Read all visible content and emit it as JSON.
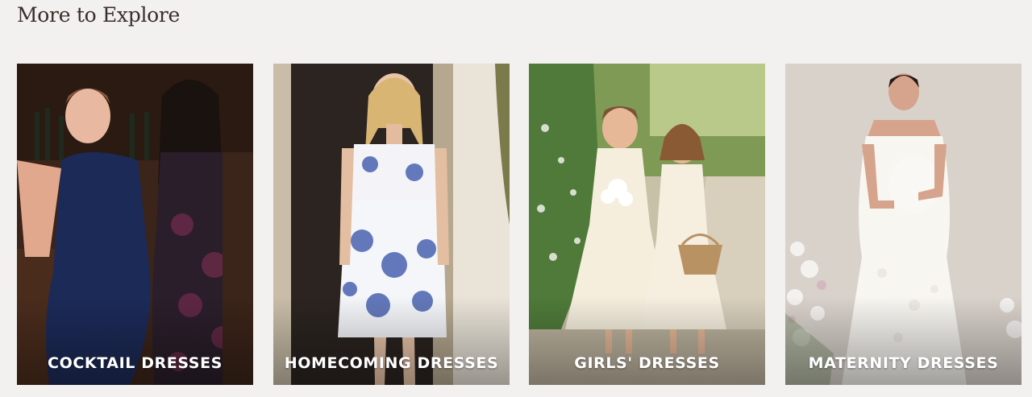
{
  "section": {
    "title": "More to Explore"
  },
  "cards": [
    {
      "label": "COCKTAIL DRESSES",
      "image": "cocktail-dresses-photo"
    },
    {
      "label": "HOMECOMING DRESSES",
      "image": "homecoming-dresses-photo"
    },
    {
      "label": "GIRLS' DRESSES",
      "image": "girls-dresses-photo"
    },
    {
      "label": "MATERNITY DRESSES",
      "image": "maternity-dresses-photo"
    }
  ],
  "colors": {
    "background": "#f2f1f0",
    "title": "#3a2e2a",
    "label": "#ffffff"
  }
}
